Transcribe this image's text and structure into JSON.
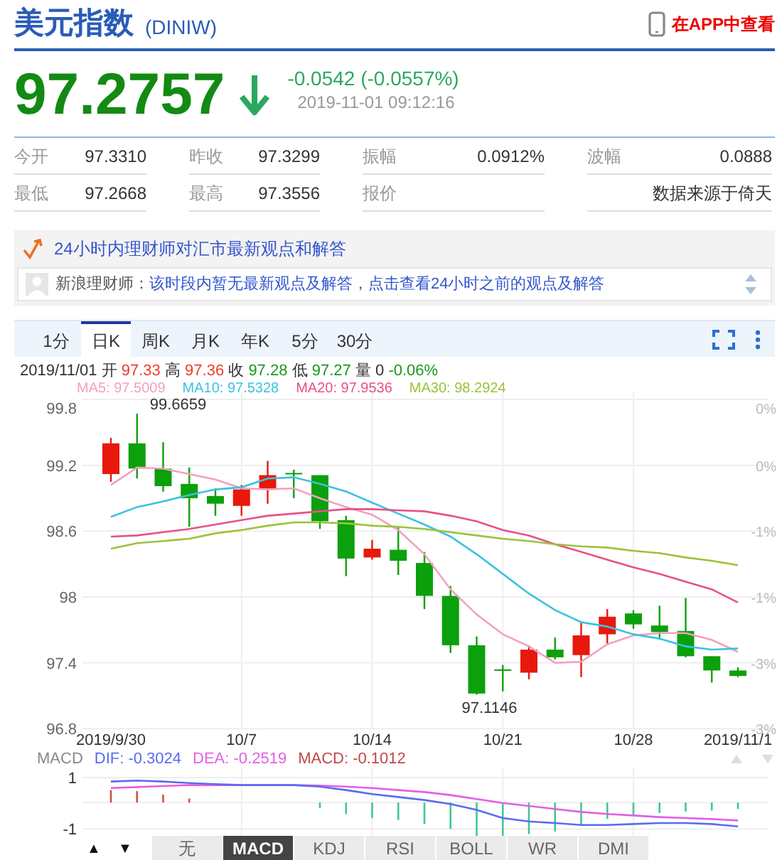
{
  "header": {
    "title": "美元指数",
    "code": "(DINIW)",
    "app_link": "在APP中查看"
  },
  "quote": {
    "price": "97.2757",
    "down": true,
    "change": "-0.0542 (-0.0557%)",
    "time": "2019-11-01 09:12:16"
  },
  "stats": [
    [
      {
        "label": "今开",
        "value": "97.3310"
      },
      {
        "label": "昨收",
        "value": "97.3299"
      },
      {
        "label": "振幅",
        "value": "0.0912%"
      },
      {
        "label": "波幅",
        "value": "0.0888"
      }
    ],
    [
      {
        "label": "最低",
        "value": "97.2668"
      },
      {
        "label": "最高",
        "value": "97.3556"
      },
      {
        "label": "报价"
      },
      {
        "value": "数据来源于倚天"
      }
    ]
  ],
  "news": {
    "title": "24小时内理财师对汇市最新观点和解答",
    "author": "新浪理财师：",
    "message": "该时段内暂无最新观点及解答，点击查看24小时之前的观点及解答"
  },
  "chart_tabs": [
    {
      "label": "1分",
      "selected": false
    },
    {
      "label": "日K",
      "selected": true
    },
    {
      "label": "周K",
      "selected": false
    },
    {
      "label": "月K",
      "selected": false
    },
    {
      "label": "年K",
      "selected": false
    },
    {
      "label": "5分",
      "selected": false
    },
    {
      "label": "30分",
      "selected": false
    }
  ],
  "ohlc": {
    "date": "2019/11/01",
    "items": [
      {
        "label": "开",
        "value": "97.33",
        "color": "#f03c2a"
      },
      {
        "label": "高",
        "value": "97.36",
        "color": "#f03c2a"
      },
      {
        "label": "收",
        "value": "97.28",
        "color": "#1a9a1a"
      },
      {
        "label": "低",
        "value": "97.27",
        "color": "#1a9a1a"
      },
      {
        "label": "量",
        "value": "0",
        "color": "#333333"
      },
      {
        "value": "-0.06%",
        "color": "#1a9a1a"
      }
    ]
  },
  "ma_legend": [
    "97.5009",
    "97.5328",
    "97.9536",
    "98.2924"
  ],
  "chart": {
    "percent_labels": [
      "0%",
      "0%",
      "-1%",
      "-1%",
      "-3%",
      "-3%"
    ],
    "chart_data": {
      "type": "candlestick",
      "categories": [
        "2019/9/30",
        null,
        null,
        null,
        null,
        "10/7",
        null,
        null,
        null,
        null,
        "10/14",
        null,
        null,
        null,
        null,
        "10/21",
        null,
        null,
        null,
        null,
        "10/28",
        null,
        null,
        null,
        "2019/11/1"
      ],
      "ylim": [
        96.8,
        99.8
      ],
      "yticks": [
        {
          "value": 96.8,
          "label": "96.8"
        },
        {
          "value": 97.4,
          "label": "97.4"
        },
        {
          "value": 98,
          "label": "98"
        },
        {
          "value": 98.6,
          "label": "98.6"
        },
        {
          "value": 99.2,
          "label": "99.2"
        },
        {
          "value": 99.8,
          "label": "99.8"
        }
      ],
      "grid": true,
      "ohlc": [
        [
          99.12,
          99.45,
          99.05,
          99.4
        ],
        [
          99.4,
          99.67,
          99.08,
          99.17
        ],
        [
          99.17,
          99.41,
          98.96,
          99.01
        ],
        [
          99.03,
          99.18,
          98.64,
          98.9
        ],
        [
          98.92,
          98.99,
          98.74,
          98.85
        ],
        [
          98.83,
          99.02,
          98.74,
          98.98
        ],
        [
          98.99,
          99.24,
          98.85,
          99.11
        ],
        [
          99.13,
          99.16,
          98.9,
          99.12
        ],
        [
          99.11,
          99.11,
          98.62,
          98.69
        ],
        [
          98.7,
          98.74,
          98.19,
          98.35
        ],
        [
          98.36,
          98.52,
          98.34,
          98.44
        ],
        [
          98.43,
          98.64,
          98.2,
          98.33
        ],
        [
          98.31,
          98.41,
          97.89,
          98.01
        ],
        [
          98.01,
          98.1,
          97.49,
          97.56
        ],
        [
          97.56,
          97.64,
          97.11,
          97.12
        ],
        [
          97.34,
          97.38,
          97.14,
          97.33
        ],
        [
          97.31,
          97.56,
          97.25,
          97.52
        ],
        [
          97.52,
          97.63,
          97.43,
          97.45
        ],
        [
          97.47,
          97.77,
          97.27,
          97.65
        ],
        [
          97.66,
          97.89,
          97.56,
          97.82
        ],
        [
          97.85,
          97.88,
          97.71,
          97.75
        ],
        [
          97.74,
          97.92,
          97.61,
          97.68
        ],
        [
          97.69,
          97.99,
          97.45,
          97.46
        ],
        [
          97.46,
          97.46,
          97.22,
          97.33
        ],
        [
          97.33,
          97.36,
          97.27,
          97.28
        ]
      ],
      "series": [
        {
          "name": "MA5:",
          "type": "line",
          "color": "#f4a0c0",
          "values": [
            99.02,
            99.18,
            99.17,
            99.12,
            99.07,
            98.99,
            98.98,
            98.99,
            98.9,
            98.82,
            98.75,
            98.61,
            98.39,
            98.07,
            97.84,
            97.66,
            97.55,
            97.4,
            97.41,
            97.57,
            97.65,
            97.67,
            97.67,
            97.61,
            97.5
          ]
        },
        {
          "name": "MA10:",
          "type": "line",
          "color": "#3cc2e0",
          "values": [
            98.73,
            98.82,
            98.87,
            98.93,
            98.98,
            99.0,
            99.08,
            99.09,
            99.03,
            98.96,
            98.86,
            98.76,
            98.66,
            98.55,
            98.39,
            98.21,
            98.03,
            97.88,
            97.77,
            97.73,
            97.66,
            97.62,
            97.55,
            97.52,
            97.53
          ]
        },
        {
          "name": "MA20:",
          "type": "line",
          "color": "#e8508a",
          "values": [
            98.55,
            98.56,
            98.59,
            98.62,
            98.66,
            98.7,
            98.74,
            98.76,
            98.78,
            98.8,
            98.8,
            98.79,
            98.78,
            98.74,
            98.69,
            98.61,
            98.56,
            98.48,
            98.41,
            98.34,
            98.27,
            98.21,
            98.14,
            98.07,
            97.95
          ]
        },
        {
          "name": "MA30:",
          "type": "line",
          "color": "#9cc23a",
          "values": [
            98.44,
            98.49,
            98.51,
            98.53,
            98.58,
            98.61,
            98.65,
            98.68,
            98.68,
            98.67,
            98.65,
            98.64,
            98.62,
            98.59,
            98.56,
            98.53,
            98.51,
            98.48,
            98.46,
            98.45,
            98.42,
            98.4,
            98.36,
            98.33,
            98.29
          ]
        }
      ],
      "annotations": [
        "99.6659",
        "97.1146"
      ]
    }
  },
  "macd": {
    "legend": [
      {
        "label": "MACD",
        "color": "#888888"
      },
      {
        "label": "DIF: -0.3024",
        "color": "#5a6cf0"
      },
      {
        "label": "DEA: -0.2519",
        "color": "#e45ee4"
      },
      {
        "label": "MACD: -0.1012",
        "color": "#c04848"
      }
    ],
    "ticks": [
      "1",
      "-1"
    ]
  },
  "indicator_nav": {
    "arrows": [
      "▲",
      "▼"
    ],
    "tabs": [
      {
        "label": "无",
        "selected": false
      },
      {
        "label": "MACD",
        "selected": true
      },
      {
        "label": "KDJ",
        "selected": false
      },
      {
        "label": "RSI",
        "selected": false
      },
      {
        "label": "BOLL",
        "selected": false
      },
      {
        "label": "WR",
        "selected": false
      },
      {
        "label": "DMI",
        "selected": false
      }
    ]
  }
}
